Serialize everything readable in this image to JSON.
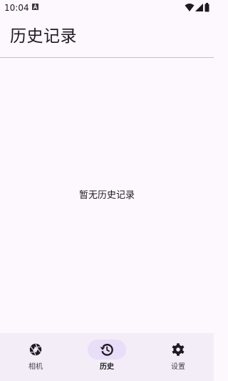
{
  "status_bar": {
    "time": "10:04",
    "icons": [
      "notification-a-icon",
      "wifi-icon",
      "signal-icon",
      "battery-icon"
    ]
  },
  "app_bar": {
    "title": "历史记录"
  },
  "main": {
    "empty_message": "暂无历史记录"
  },
  "bottom_nav": {
    "items": [
      {
        "label": "相机",
        "icon": "camera-aperture-icon",
        "active": false
      },
      {
        "label": "历史",
        "icon": "history-icon",
        "active": true
      },
      {
        "label": "设置",
        "icon": "settings-gear-icon",
        "active": false
      }
    ]
  },
  "colors": {
    "background": "#fdf7fe",
    "nav_background": "#f3edf7",
    "active_indicator": "#e8def8",
    "text_primary": "#1d1b20",
    "text_secondary": "#49454f",
    "divider": "#c4c0c6"
  }
}
